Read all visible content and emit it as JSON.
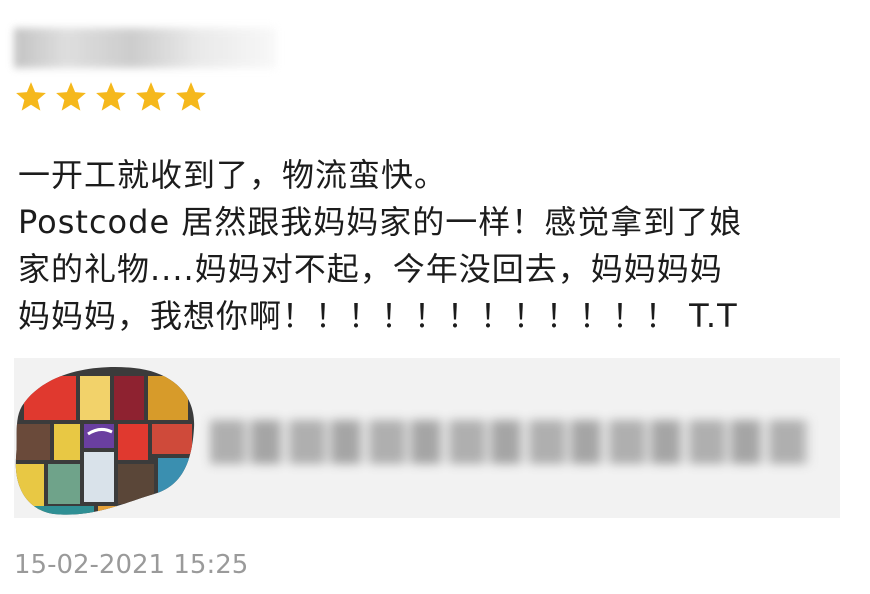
{
  "rating": {
    "stars_filled": 5,
    "stars_total": 5,
    "star_color": "#f5b81c"
  },
  "review": {
    "lines": [
      "一开工就收到了，物流蛮快。",
      "Postcode 居然跟我妈妈家的一样！感觉拿到了娘",
      "家的礼物....妈妈对不起，今年没回去，妈妈妈妈",
      "妈妈妈，我想你啊！！！！！！！！！！！！ T.T"
    ]
  },
  "product": {
    "card_color": "#f2f2f2"
  },
  "timestamp": "15-02-2021 15:25"
}
